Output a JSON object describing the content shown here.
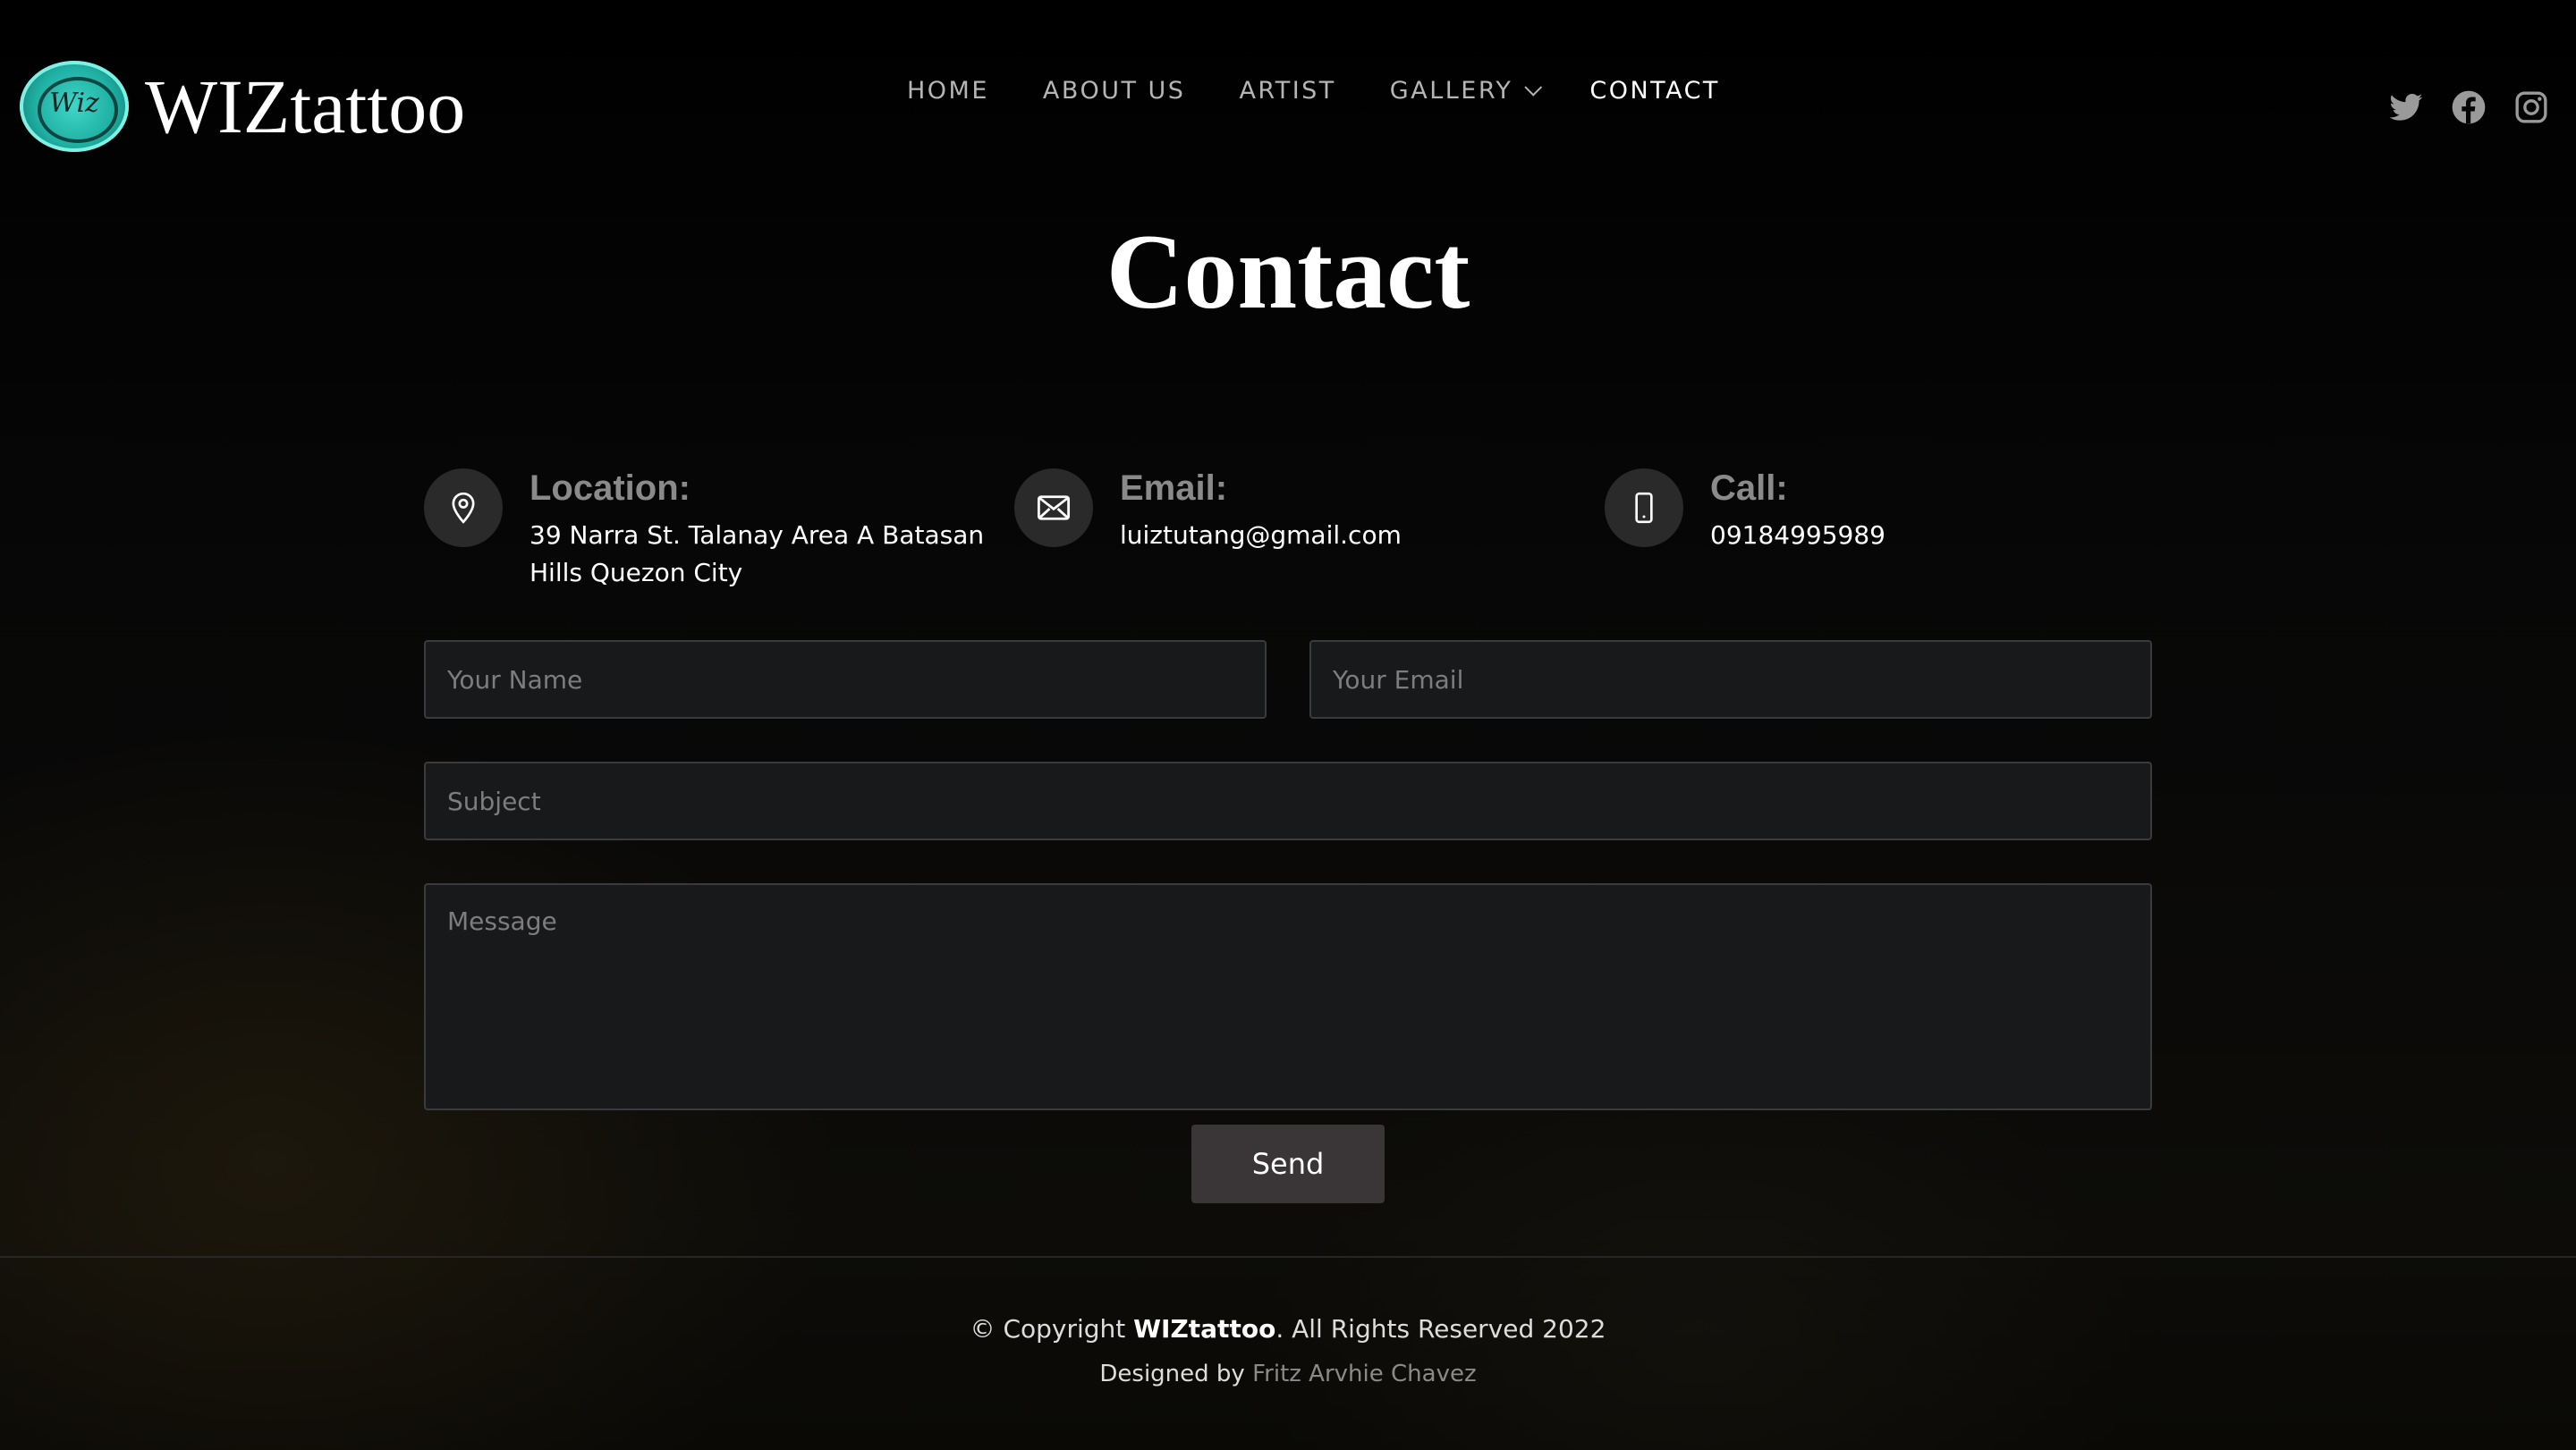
{
  "brand": {
    "name": "WIZtattoo",
    "badge_text": "Wiz"
  },
  "nav": {
    "items": [
      {
        "label": "HOME"
      },
      {
        "label": "ABOUT US"
      },
      {
        "label": "ARTIST"
      },
      {
        "label": "GALLERY"
      },
      {
        "label": "CONTACT"
      }
    ],
    "active": "CONTACT"
  },
  "social": [
    "twitter-icon",
    "facebook-icon",
    "instagram-icon"
  ],
  "page": {
    "title": "Contact"
  },
  "info": {
    "location": {
      "label": "Location:",
      "line1": "39 Narra St. Talanay Area A Batasan",
      "line2": "Hills Quezon City"
    },
    "email": {
      "label": "Email:",
      "value": "luiztutang@gmail.com"
    },
    "call": {
      "label": "Call:",
      "value": "09184995989"
    }
  },
  "form": {
    "name_placeholder": "Your Name",
    "email_placeholder": "Your Email",
    "subject_placeholder": "Subject",
    "message_placeholder": "Message",
    "send_label": "Send"
  },
  "footer": {
    "copyright_prefix": "© Copyright ",
    "copyright_brand": "WIZtattoo",
    "copyright_suffix": ". All Rights Reserved 2022",
    "designed_prefix": "Designed by ",
    "designer": "Fritz Arvhie Chavez"
  },
  "colors": {
    "background": "#050505",
    "field_bg": "#18191b",
    "button_bg": "#3a3536",
    "logo_teal": "#1fb0a3"
  }
}
